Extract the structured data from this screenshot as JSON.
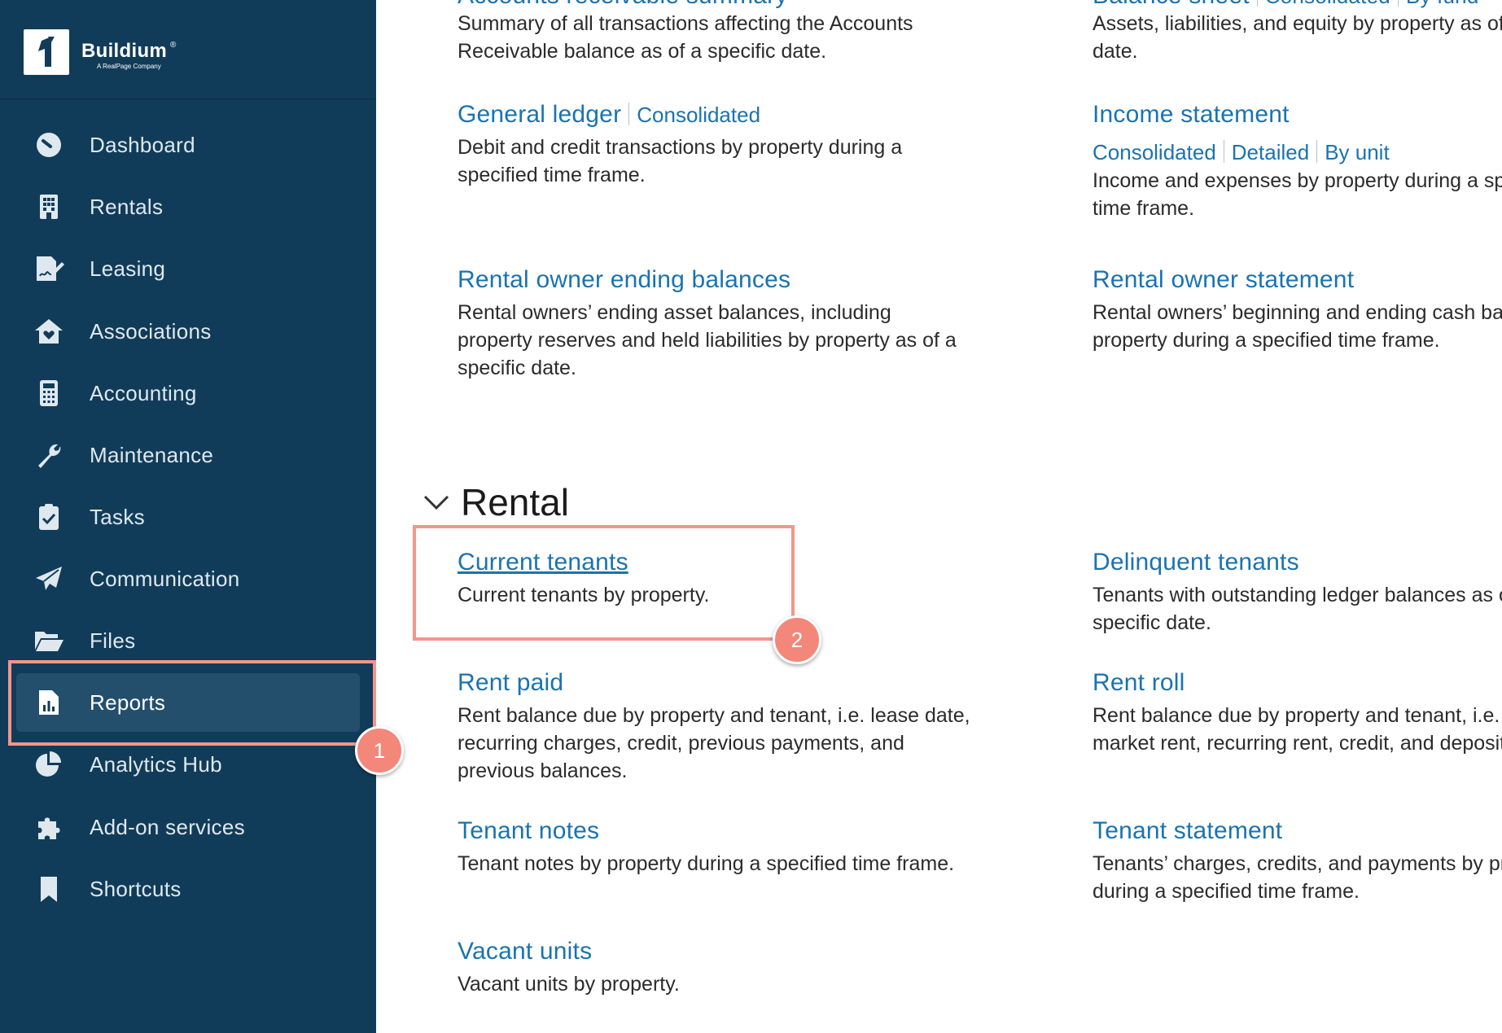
{
  "brand": {
    "name": "Buildium",
    "trademark": "®",
    "tagline": "A RealPage Company"
  },
  "sidebar": {
    "items": [
      {
        "label": "Dashboard",
        "icon": "dashboard-gauge-icon"
      },
      {
        "label": "Rentals",
        "icon": "building-icon"
      },
      {
        "label": "Leasing",
        "icon": "signed-document-icon"
      },
      {
        "label": "Associations",
        "icon": "house-heart-icon"
      },
      {
        "label": "Accounting",
        "icon": "calculator-icon"
      },
      {
        "label": "Maintenance",
        "icon": "wrench-icon"
      },
      {
        "label": "Tasks",
        "icon": "clipboard-check-icon"
      },
      {
        "label": "Communication",
        "icon": "paper-plane-icon"
      },
      {
        "label": "Files",
        "icon": "folder-open-icon"
      },
      {
        "label": "Reports",
        "icon": "report-chart-icon",
        "active": true
      },
      {
        "label": "Analytics Hub",
        "icon": "pie-chart-icon"
      },
      {
        "label": "Add-on services",
        "icon": "puzzle-piece-icon"
      },
      {
        "label": "Shortcuts",
        "icon": "bookmark-icon"
      }
    ]
  },
  "financial": {
    "ar_summary": {
      "title": "Accounts receivable summary",
      "desc1": "Summary of all transactions affecting the Accounts",
      "desc2": "Receivable balance as of a specific date."
    },
    "balance_sheet": {
      "title": "Balance sheet",
      "variants": [
        "Consolidated",
        "By fund"
      ],
      "desc1": "Assets, liabilities, and equity by property as of a specific",
      "desc2": "date."
    },
    "general_ledger": {
      "title": "General ledger",
      "variants": [
        "Consolidated"
      ],
      "desc1": "Debit and credit transactions by property during a",
      "desc2": "specified time frame."
    },
    "income_statement": {
      "title": "Income statement",
      "variants": [
        "Consolidated",
        "Detailed",
        "By unit"
      ],
      "desc1": "Income and expenses by property during a specified",
      "desc2": "time frame."
    },
    "owner_ending_balances": {
      "title": "Rental owner ending balances",
      "desc1": "Rental owners’ ending asset balances, including",
      "desc2": "property reserves and held liabilities by property as of a",
      "desc3": "specific date."
    },
    "owner_statement": {
      "title": "Rental owner statement",
      "desc1": "Rental owners’ beginning and ending cash balances by",
      "desc2": "property during a specified time frame."
    }
  },
  "rental_section": {
    "title": "Rental",
    "current_tenants": {
      "title": "Current tenants",
      "desc1": "Current tenants by property."
    },
    "delinquent_tenants": {
      "title": "Delinquent tenants",
      "desc1": "Tenants with outstanding ledger balances as of a",
      "desc2": "specific date."
    },
    "rent_paid": {
      "title": "Rent paid",
      "desc1": "Rent balance due by property and tenant, i.e. lease date,",
      "desc2": "recurring charges, credit, previous payments, and",
      "desc3": "previous balances."
    },
    "rent_roll": {
      "title": "Rent roll",
      "desc1": "Rent balance due by property and tenant, i.e. lease date,",
      "desc2": "market rent, recurring rent, credit, and deposits."
    },
    "tenant_notes": {
      "title": "Tenant notes",
      "desc1": "Tenant notes by property during a specified time frame."
    },
    "tenant_statement": {
      "title": "Tenant statement",
      "desc1": "Tenants’ charges, credits, and payments by property",
      "desc2": "during a specified time frame."
    },
    "vacant_units": {
      "title": "Vacant units",
      "desc1": "Vacant units by property."
    }
  },
  "annotations": {
    "step1": "1",
    "step2": "2",
    "highlight_color": "#f3968a"
  },
  "colors": {
    "sidebar_bg": "#113c59",
    "active_item_bg": "#234f6d",
    "link": "#1a73b0",
    "text": "#2b2b2b"
  }
}
